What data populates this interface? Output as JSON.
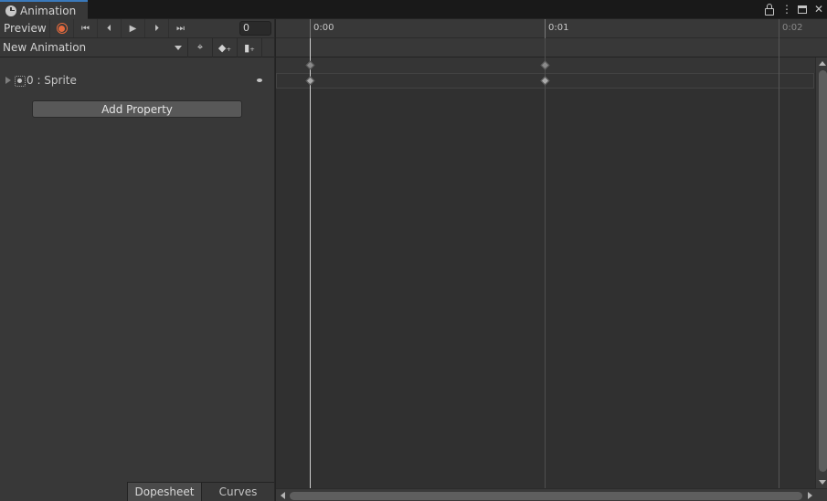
{
  "window": {
    "tab_title": "Animation",
    "tab_icon": "clock-icon",
    "controls": [
      "lock-icon",
      "kebab-menu-icon",
      "maximize-icon",
      "close-icon"
    ],
    "kebab_glyph": "⋮",
    "close_glyph": "✕"
  },
  "toolbar": {
    "preview_label": "Preview",
    "record_icon": "record-icon",
    "first_key_glyph": "⏮",
    "prev_key_glyph": "⏴",
    "play_glyph": "▶",
    "next_key_glyph": "⏵",
    "last_key_glyph": "⏭",
    "frame_value": "0"
  },
  "clip": {
    "selected": "New Animation",
    "add_keyframe_icon": "add-keyframe-icon",
    "add_event_icon": "add-event-icon",
    "filter_icon": "sample-filter-icon",
    "filter_glyph": "⌖",
    "add_key_glyph": "◆₊",
    "add_event_glyph": "▮₊"
  },
  "properties": [
    {
      "label": "0 : Sprite",
      "icon": "sprite-icon"
    }
  ],
  "add_property_label": "Add Property",
  "bottom_tabs": {
    "dopesheet": "Dopesheet",
    "curves": "Curves"
  },
  "timeline": {
    "labels": [
      "0:00",
      "0:01",
      "0:02"
    ],
    "keyframe_times": [
      "0:00",
      "0:01"
    ],
    "current_time": "0:00"
  },
  "colors": {
    "accent": "#3a79bb",
    "record": "#e46a3e",
    "panel": "#383838",
    "timeline_bg": "#303030"
  }
}
